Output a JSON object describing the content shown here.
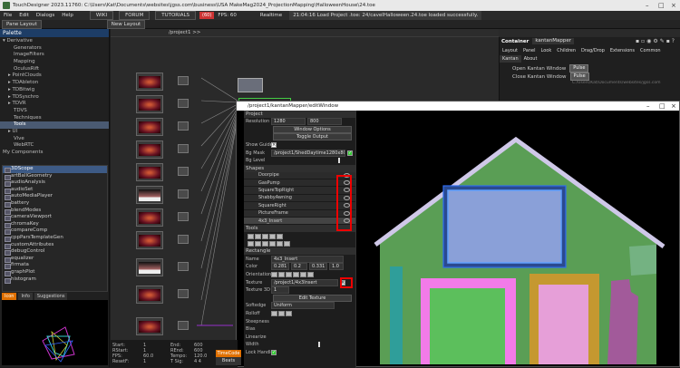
{
  "window": {
    "title": "TouchDesigner 2023.11760: C:\\Users\\Kat\\Documents\\websites\\jgss.com\\business\\USA MakeMag2024_ProjectionMapping\\HalloweenHouse\\24.toe"
  },
  "menu": {
    "items": [
      "File",
      "Edit",
      "Dialogs",
      "Help"
    ],
    "wiki": "WIKI",
    "forum": "FORUM",
    "tutorials": "TUTORIALS",
    "fps_badge": "(60)",
    "fps_label": "FPS: 60",
    "realtime": "Realtime",
    "status_msg": "21:04:16 Load Project .toe: 24/cavelHalloween.24.toe loaded successfully."
  },
  "toolbar": {
    "pane_layout": "Pane Layout",
    "new_layout": "New Layout"
  },
  "palette": {
    "title": "Palette",
    "tree": [
      {
        "label": "Derivative",
        "indent": 0,
        "prefix": "▾"
      },
      {
        "label": "Generators",
        "indent": 2,
        "prefix": ""
      },
      {
        "label": "ImageFilters",
        "indent": 2,
        "prefix": ""
      },
      {
        "label": "Mapping",
        "indent": 2,
        "prefix": ""
      },
      {
        "label": "OculusRift",
        "indent": 2,
        "prefix": ""
      },
      {
        "label": "PointClouds",
        "indent": 1,
        "prefix": "▸"
      },
      {
        "label": "TDAbleton",
        "indent": 1,
        "prefix": "▸"
      },
      {
        "label": "TDBitwig",
        "indent": 1,
        "prefix": "▸"
      },
      {
        "label": "TDSyschro",
        "indent": 1,
        "prefix": "▸"
      },
      {
        "label": "TDVR",
        "indent": 1,
        "prefix": "▸"
      },
      {
        "label": "TDVS",
        "indent": 2,
        "prefix": ""
      },
      {
        "label": "Techniques",
        "indent": 2,
        "prefix": ""
      },
      {
        "label": "Tools",
        "indent": 2,
        "prefix": ""
      },
      {
        "label": "UI",
        "indent": 1,
        "prefix": "▸"
      },
      {
        "label": "Vive",
        "indent": 2,
        "prefix": ""
      },
      {
        "label": "WebRTC",
        "indent": 2,
        "prefix": ""
      },
      {
        "label": "My Components",
        "indent": 0,
        "prefix": ""
      }
    ],
    "selected_tree_index": 12,
    "components": [
      "3DScope",
      "artBallGeometry",
      "audioAnalysis",
      "audioSet",
      "autoMediaPlayer",
      "battery",
      "blendModes",
      "cameraViewport",
      "chromaKey",
      "compareComp",
      "cppParsTemplateGen",
      "customAttributes",
      "debugControl",
      "equalizer",
      "firmata",
      "graphPlot",
      "histogram"
    ],
    "selected_component_index": 0,
    "info_tabs": [
      "Icon",
      "Info",
      "Suggestions"
    ]
  },
  "network": {
    "path": "/project1 >>"
  },
  "container": {
    "title": "Container",
    "name": "kantanMapper",
    "tabs": [
      "Layout",
      "Panel",
      "Look",
      "Children",
      "Drag/Drop",
      "Extensions",
      "Common"
    ],
    "subtabs": [
      "Kantan",
      "About"
    ],
    "open_label": "Open Kantan Window",
    "close_label": "Close Kantan Window",
    "pulse": "Pulse",
    "path_text": "C:/Users/Kat/Documents/websites/jgss.com"
  },
  "editor": {
    "title": "/project1/kantanMapper/editWindow",
    "project_section": "Project",
    "resolution_label": "Resolution",
    "res_w": "1280",
    "res_h": "800",
    "window_options": "Window Options",
    "toggle_output": "Toggle Output",
    "show_guide": "Show Guide",
    "bg_mask_label": "Bg Mask",
    "bg_mask_value": "/project1/ShedDaytime1280x800",
    "bg_level_label": "Bg Level",
    "shapes_section": "Shapes",
    "shapes": [
      "Doorpipe",
      "GasPump",
      "SquareTopRight",
      "ShabbyAwning",
      "SquareRight",
      "PictureFrame",
      "4x3_Insert"
    ],
    "selected_shape_index": 6,
    "tools_section": "Tools",
    "rectangle_section": "Rectangle",
    "name_label": "Name",
    "name_value": "4x3_Insert",
    "color_label": "Color",
    "color_values": [
      "0.281",
      "0.2",
      "0.331",
      "1.0"
    ],
    "orientation_label": "Orientation",
    "texture_label": "Texture",
    "texture_value": "/project1/4x3Insert",
    "texture3d_label": "Texture 3D",
    "texture3d_value": "1",
    "edit_texture": "Edit Texture",
    "softedge_label": "Softedge",
    "softedge_value": "Uniform",
    "rolloff_label": "Rolloff",
    "steepness_label": "Steepness",
    "bias_label": "Bias",
    "linearize_label": "Linearize",
    "width_label": "Width",
    "lock_handles_label": "Lock Handles"
  },
  "timeline": {
    "start_label": "Start:",
    "start": "1",
    "end_label": "End:",
    "end": "600",
    "rstart_label": "RStart:",
    "rstart": "1",
    "rend_label": "REnd:",
    "rend": "600",
    "fps_label": "FPS:",
    "fps": "60.0",
    "tempo_label": "Tempo:",
    "tempo": "120.0",
    "reset_label": "ResetF:",
    "reset": "1",
    "tsig_label": "T Sig:",
    "tsig": "4  4",
    "timecode": "TimeCode",
    "beats": "Beats"
  },
  "colors": {
    "accent": "#e07000",
    "highlight_red": "#e00000",
    "sky_house": "#5a9e55",
    "window_blue": "#2a4a8f",
    "pink_door": "#f27be8",
    "green_wall": "#5cbf5c"
  }
}
